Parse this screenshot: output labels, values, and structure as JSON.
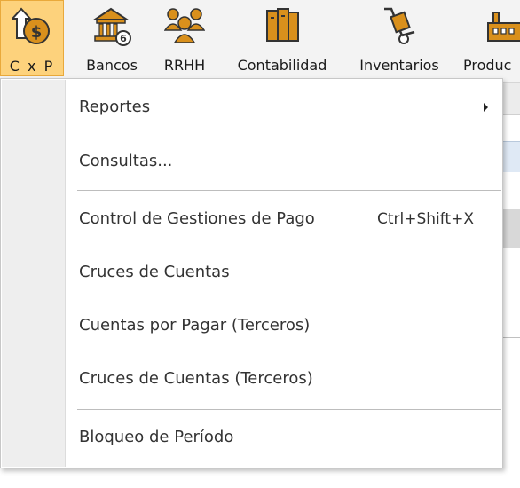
{
  "ribbon": {
    "tabs": [
      {
        "label": "C x P",
        "icon": "money-up-icon"
      },
      {
        "label": "Bancos",
        "icon": "bank-icon"
      },
      {
        "label": "RRHH",
        "icon": "people-icon"
      },
      {
        "label": "Contabilidad",
        "icon": "ledger-books-icon"
      },
      {
        "label": "Inventarios",
        "icon": "hand-truck-icon"
      },
      {
        "label": "Produc",
        "icon": "factory-icon"
      }
    ]
  },
  "menu": {
    "items": [
      {
        "label": "Reportes",
        "submenu": true
      },
      {
        "label": "Consultas..."
      },
      {
        "label": "Control de Gestiones de Pago",
        "shortcut": "Ctrl+Shift+X"
      },
      {
        "label": "Cruces de Cuentas"
      },
      {
        "label": "Cuentas por Pagar (Terceros)"
      },
      {
        "label": "Cruces de Cuentas (Terceros)"
      },
      {
        "label": "Bloqueo de Período"
      }
    ]
  },
  "colors": {
    "active_tab_bg": "#fdd27c",
    "active_tab_border": "#e9a93b",
    "icon_gold": "#d9901c"
  }
}
